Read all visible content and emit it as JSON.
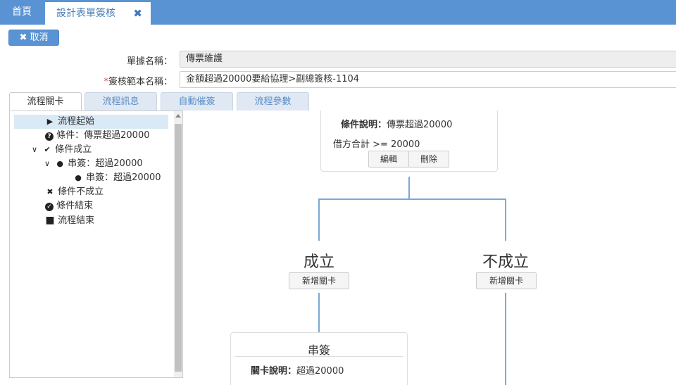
{
  "topbar": {
    "home_label": "首頁",
    "active_tab_label": "設計表單簽核",
    "close_glyph": "✖"
  },
  "toolbar": {
    "cancel_label": "✖ 取消"
  },
  "form": {
    "doc_name_label": "單據名稱：",
    "doc_name_value": "傳票維護",
    "template_required_mark": "*",
    "template_label": "簽核範本名稱：",
    "template_value": "金額超過20000要給協理>副總簽核-1104"
  },
  "subtabs": [
    "流程關卡",
    "流程訊息",
    "自動催簽",
    "流程參數"
  ],
  "tree": {
    "items": [
      {
        "icon": "▶",
        "label": "流程起始"
      },
      {
        "icon": "?",
        "label": "條件：傳票超過20000"
      },
      {
        "chevron": "v",
        "icon": "✔",
        "label": "條件成立"
      },
      {
        "chevron": "v",
        "icon": "👤",
        "label": "串簽：超過20000"
      },
      {
        "icon": "👤",
        "label": "串簽：超過20000"
      },
      {
        "icon": "✖",
        "label": "條件不成立"
      },
      {
        "icon": "✔",
        "label": "條件結束"
      },
      {
        "icon": "■",
        "label": "流程結束"
      }
    ]
  },
  "flow": {
    "condition_card": {
      "desc_label": "條件說明：",
      "desc_value": "傳票超過20000",
      "rule": "借方合計 >= 20000",
      "edit_label": "編輯",
      "delete_label": "刪除"
    },
    "branch_true": {
      "label": "成立",
      "add_label": "新增關卡"
    },
    "branch_false": {
      "label": "不成立",
      "add_label": "新增關卡"
    },
    "serial_card": {
      "title": "串簽",
      "desc_label": "關卡說明：",
      "desc_value": "超過20000"
    }
  }
}
